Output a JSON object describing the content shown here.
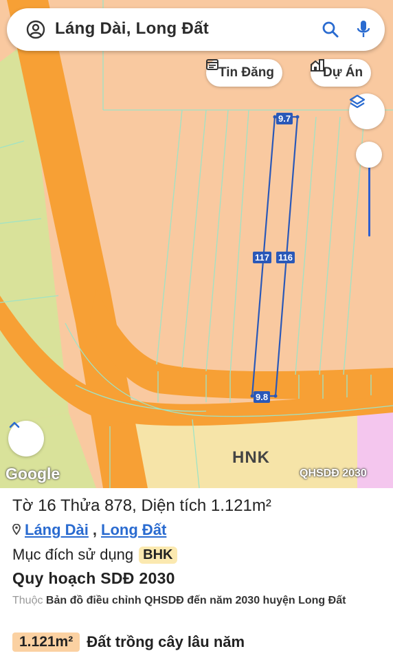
{
  "search": {
    "query": "Láng Dài, Long Đất"
  },
  "toolbar": {
    "listings_label": "Tin Đăng",
    "projects_label": "Dự Án"
  },
  "map": {
    "edge_labels": {
      "top": "9.7",
      "left": "117",
      "right": "116",
      "bottom": "9.8"
    },
    "zone_label": "HNK",
    "attribution": "Google",
    "layer_name": "QHSDĐ 2030",
    "colors": {
      "residential": "#f9c9a0",
      "road": "#f7a035",
      "agri": "#f6e4a8",
      "forest": "#d9e29a",
      "parcel_line": "#2a58b8"
    }
  },
  "sheet": {
    "title": "Tờ 16 Thửa 878, Diện tích 1.121m²",
    "location": {
      "ward": "Láng Dài",
      "district": "Long Đất"
    },
    "purpose_label": "Mục đích sử dụng",
    "purpose_code": "BHK",
    "plan_title": "Quy hoạch SDĐ 2030",
    "plan_prefix": "Thuộc",
    "plan_desc": "Bản đồ điều chỉnh QHSDĐ đến năm 2030 huyện Long Đất",
    "area": "1.121m²",
    "land_type": "Đất trồng cây lâu năm"
  }
}
